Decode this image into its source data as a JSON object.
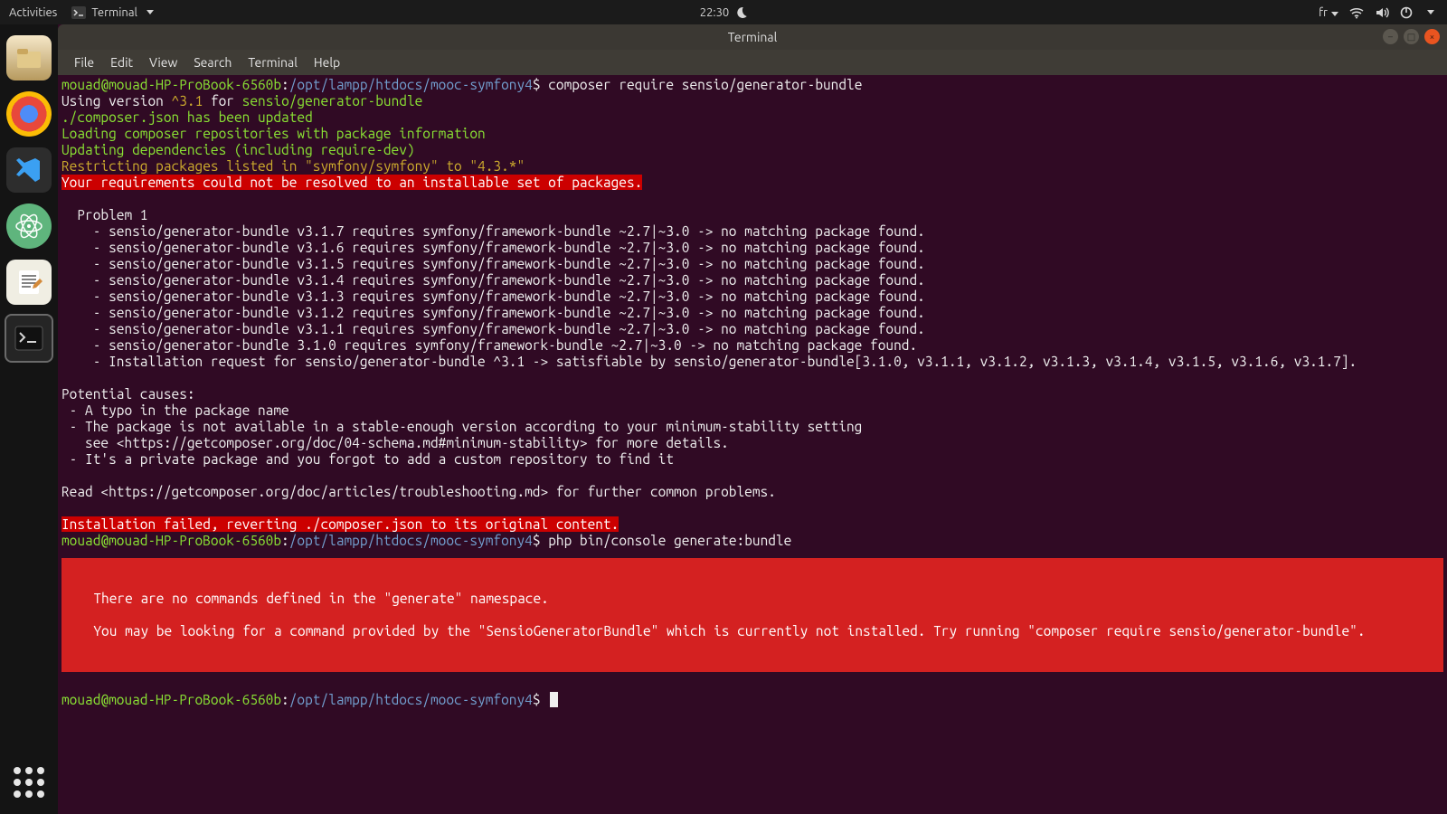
{
  "panel": {
    "activities": "Activities",
    "app_name": "Terminal",
    "clock": "22:30",
    "lang": "fr"
  },
  "dock": {
    "files": "Files",
    "chrome": "Chrome",
    "vscode": "VS Code",
    "atom": "Atom",
    "gedit": "Text Editor",
    "terminal": "Terminal",
    "apps": "Show Applications"
  },
  "window": {
    "title": "Terminal",
    "menu": {
      "file": "File",
      "edit": "Edit",
      "view": "View",
      "search": "Search",
      "terminal": "Terminal",
      "help": "Help"
    },
    "controls": {
      "min": "–",
      "max": "□",
      "close": "×"
    }
  },
  "prompt": {
    "user_host": "mouad@mouad-HP-ProBook-6560b",
    "path": "/opt/lampp/htdocs/mooc-symfony4",
    "sep": ":",
    "dollar": "$"
  },
  "cmds": {
    "c1": "composer require sensio/generator-bundle",
    "c2": "php bin/console generate:bundle"
  },
  "out": {
    "l1a": "Using version ",
    "l1b": "^3.1",
    "l1c": " for ",
    "l1d": "sensio/generator-bundle",
    "l2": "./composer.json has been updated",
    "l3": "Loading composer repositories with package information",
    "l4": "Updating dependencies (including require-dev)",
    "l5": "Restricting packages listed in \"symfony/symfony\" to \"4.3.*\"",
    "l6": "Your requirements could not be resolved to an installable set of packages.",
    "p_hdr": "  Problem 1",
    "p1": "    - sensio/generator-bundle v3.1.7 requires symfony/framework-bundle ~2.7|~3.0 -> no matching package found.",
    "p2": "    - sensio/generator-bundle v3.1.6 requires symfony/framework-bundle ~2.7|~3.0 -> no matching package found.",
    "p3": "    - sensio/generator-bundle v3.1.5 requires symfony/framework-bundle ~2.7|~3.0 -> no matching package found.",
    "p4": "    - sensio/generator-bundle v3.1.4 requires symfony/framework-bundle ~2.7|~3.0 -> no matching package found.",
    "p5": "    - sensio/generator-bundle v3.1.3 requires symfony/framework-bundle ~2.7|~3.0 -> no matching package found.",
    "p6": "    - sensio/generator-bundle v3.1.2 requires symfony/framework-bundle ~2.7|~3.0 -> no matching package found.",
    "p7": "    - sensio/generator-bundle v3.1.1 requires symfony/framework-bundle ~2.7|~3.0 -> no matching package found.",
    "p8": "    - sensio/generator-bundle 3.1.0 requires symfony/framework-bundle ~2.7|~3.0 -> no matching package found.",
    "p9": "    - Installation request for sensio/generator-bundle ^3.1 -> satisfiable by sensio/generator-bundle[3.1.0, v3.1.1, v3.1.2, v3.1.3, v3.1.4, v3.1.5, v3.1.6, v3.1.7].",
    "c_hdr": "Potential causes:",
    "c1": " - A typo in the package name",
    "c2": " - The package is not available in a stable-enough version according to your minimum-stability setting",
    "c2b": "   see <https://getcomposer.org/doc/04-schema.md#minimum-stability> for more details.",
    "c3": " - It's a private package and you forgot to add a custom repository to find it",
    "read": "Read <https://getcomposer.org/doc/articles/troubleshooting.md> for further common problems.",
    "fail": "Installation failed, reverting ./composer.json to its original content.",
    "err1": "  There are no commands defined in the \"generate\" namespace.                                                                                                                  ",
    "err_gap": "                                                                                                                                                                                ",
    "err2": "  You may be looking for a command provided by the \"SensioGeneratorBundle\" which is currently not installed. Try running \"composer require sensio/generator-bundle\".  "
  }
}
